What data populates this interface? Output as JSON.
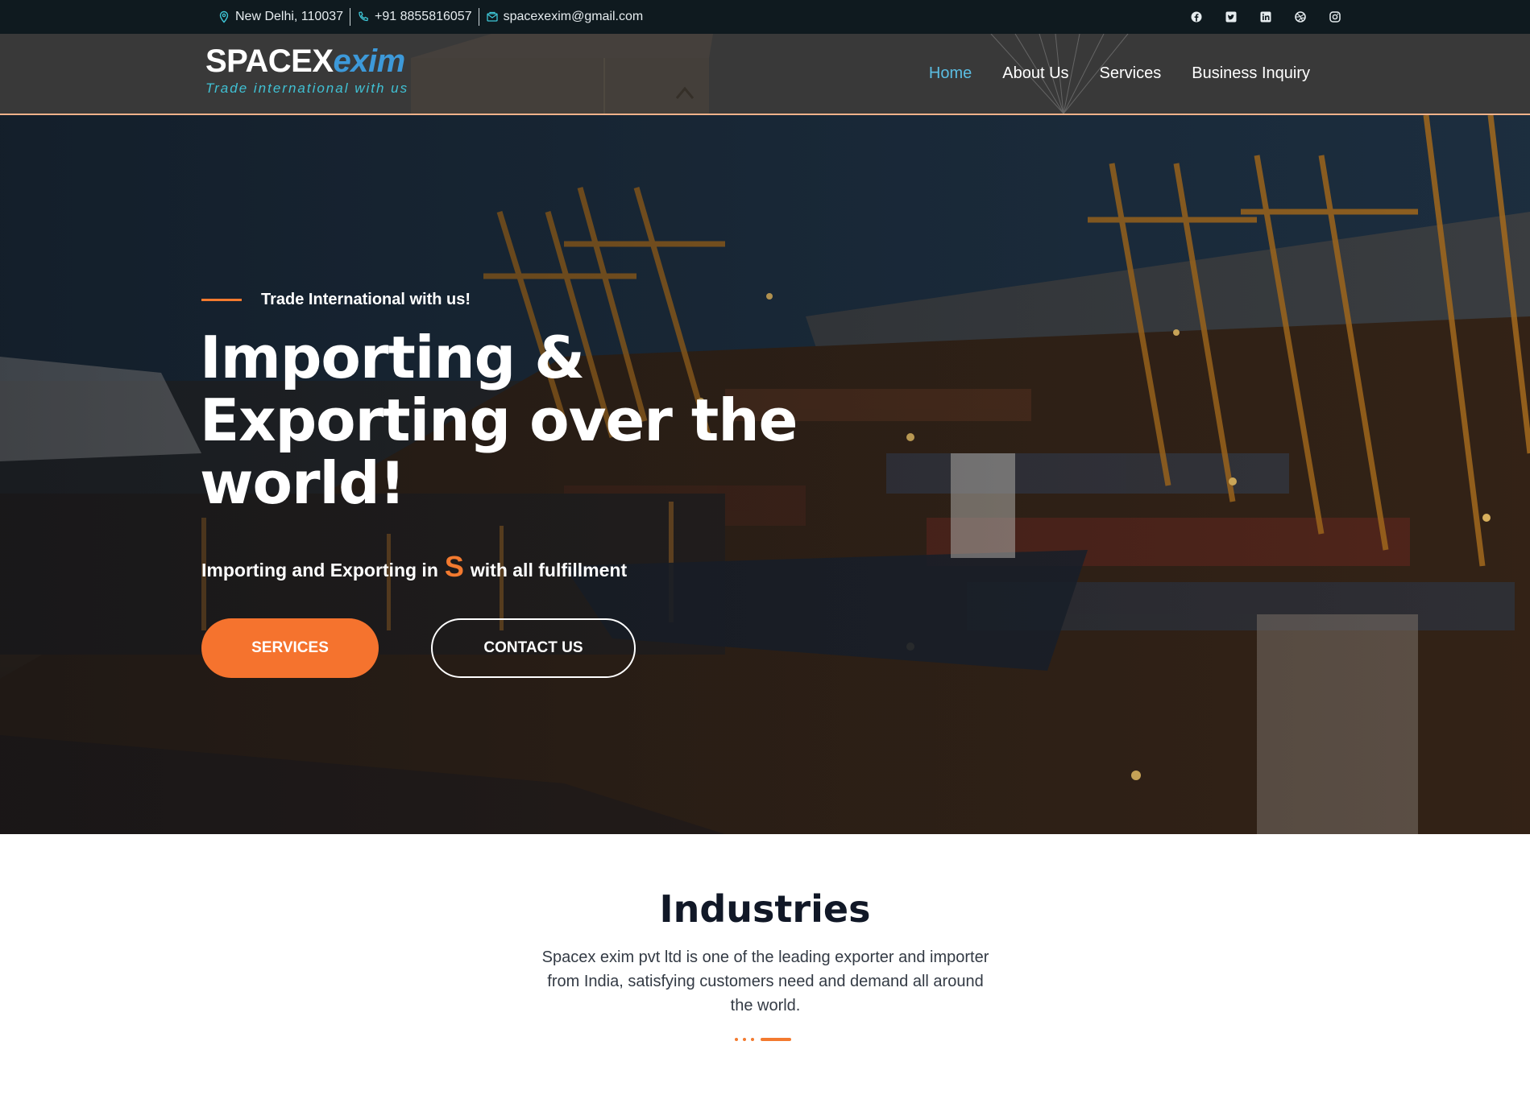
{
  "topbar": {
    "address": "New Delhi, 110037",
    "phone": "+91 8855816057",
    "email": "spacexexim@gmail.com",
    "icons": [
      "location-icon",
      "phone-icon",
      "email-icon"
    ],
    "social": [
      "facebook-icon",
      "twitter-icon",
      "linkedin-icon",
      "dribbble-icon",
      "instagram-icon"
    ]
  },
  "logo": {
    "main": "SPACEX",
    "accent": "exim",
    "tagline": "Trade international with us"
  },
  "nav": {
    "items": [
      {
        "label": "Home",
        "active": true
      },
      {
        "label": "About Us",
        "active": false
      },
      {
        "label": "Services",
        "active": false
      },
      {
        "label": "Business Inquiry",
        "active": false
      }
    ]
  },
  "hero": {
    "kicker": "Trade International with us!",
    "headline_line1": "Importing &",
    "headline_line2": "Exporting over the",
    "headline_line3": "world!",
    "sub_before": "Importing and Exporting in",
    "sub_highlight": "S",
    "sub_after": "with all fulfillment",
    "btn_services": "SERVICES",
    "btn_contact": "CONTACT US"
  },
  "industries": {
    "title": "Industries",
    "description": "Spacex exim pvt ltd is one of the leading exporter and importer from India, satisfying customers need and demand all around the world."
  },
  "colors": {
    "accent_orange": "#f5732e",
    "nav_active": "#5bbde2",
    "logo_accent": "#3d99d9",
    "tagline": "#40c1d4",
    "topbar_bg": "#0f1a1f"
  }
}
